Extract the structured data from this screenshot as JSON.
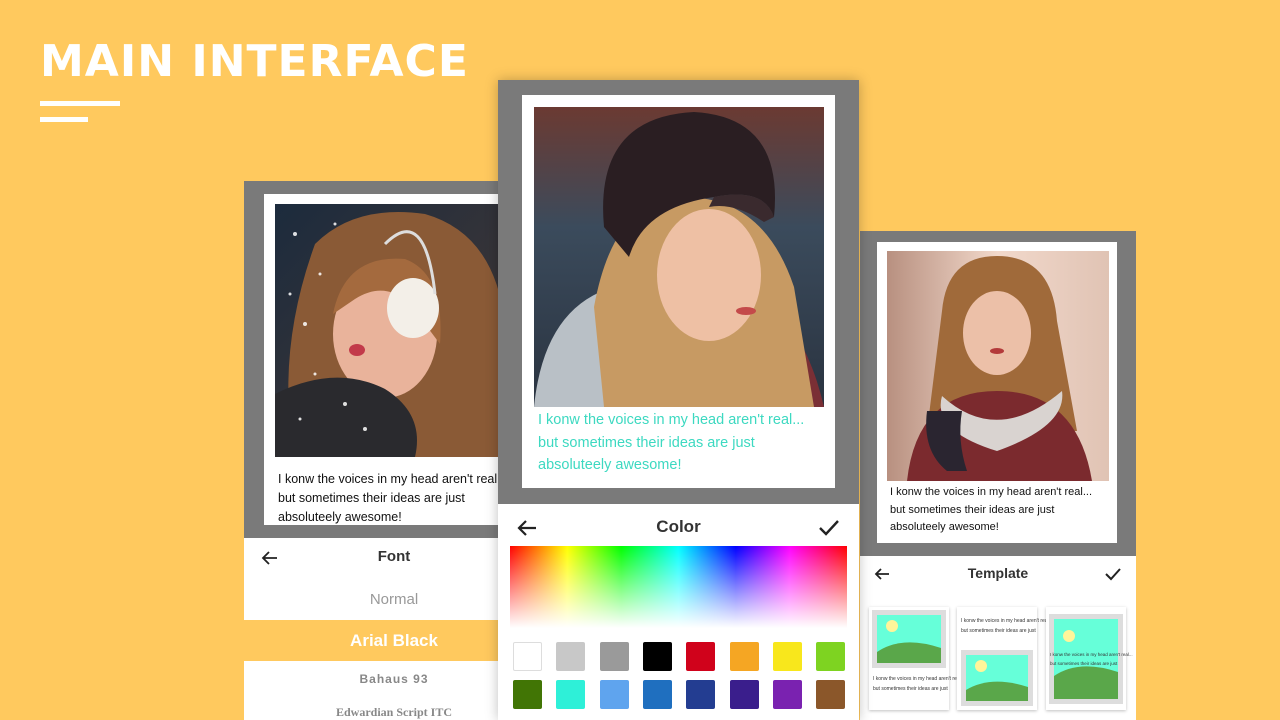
{
  "headline": "MAIN INTERFACE",
  "caption_text": {
    "line1": "I konw the voices in my head aren't real...",
    "line2": "but sometimes their ideas are just",
    "line3": "absoluteely awesome!"
  },
  "left_phone": {
    "caption": {
      "line1": "I konw the voices in my head aren't real...",
      "line2": "but sometimes their ideas are just",
      "line3": "absoluteely awesome!"
    },
    "panel_title": "Font",
    "fonts": [
      "Normal",
      "Arial Black",
      "Bahaus 93",
      "Edwardian Script ITC"
    ],
    "selected_font": "Arial Black"
  },
  "center_phone": {
    "caption": {
      "line1": "I konw the voices in my head aren't real...",
      "line2": "but sometimes their ideas are just",
      "line3": "absoluteely awesome!"
    },
    "caption_color": "#3DD9C1",
    "panel_title": "Color",
    "swatches": [
      "#FFFFFF",
      "#C8C8C8",
      "#9A9A9A",
      "#000000",
      "#D0021B",
      "#F5A623",
      "#F8E71C",
      "#7ED321",
      "#417505",
      "#2EF0D8",
      "#5FA4EE",
      "#1F6FBF",
      "#233D91",
      "#3A1E8C",
      "#7A22B0",
      "#8B572A"
    ]
  },
  "right_phone": {
    "caption": {
      "line1": "I konw the voices in my head aren't real...",
      "line2": "but sometimes their ideas are just",
      "line3": "absoluteely awesome!"
    },
    "panel_title": "Template",
    "template_text": {
      "line1": "I konw the voices in my head aren't real...",
      "line2": "but sometimes their ideas are just"
    }
  },
  "colors": {
    "background": "#FFC95E",
    "frame_gray": "#7A7A7A",
    "selected_row": "#FFC95E"
  }
}
